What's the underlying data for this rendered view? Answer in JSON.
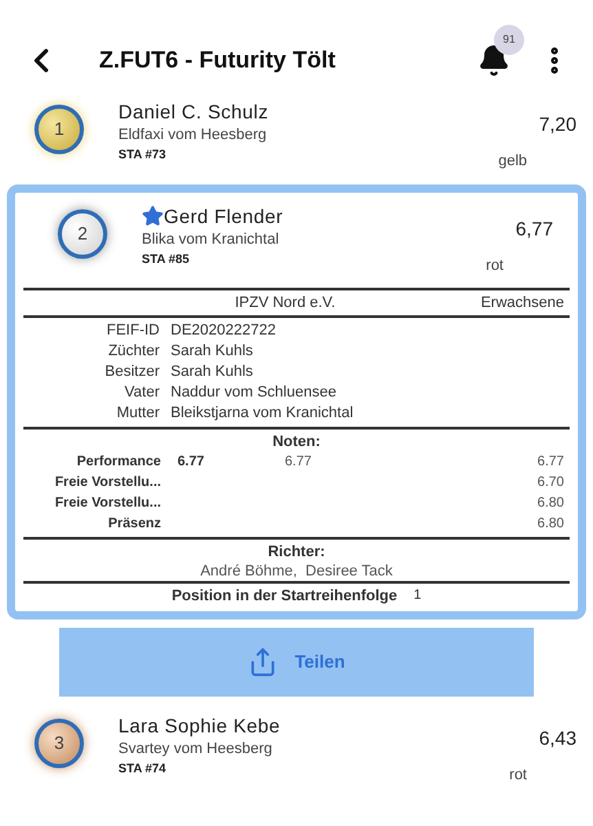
{
  "header": {
    "title": "Z.FUT6 - Futurity Tölt",
    "notification_count": "91"
  },
  "entries": [
    {
      "rank": "1",
      "kind": "gold",
      "favorite": false,
      "expanded": false,
      "rider": "Daniel C. Schulz",
      "horse": "Eldfaxi vom Heesberg",
      "start": "STA #73",
      "score": "7,20",
      "hand": "gelb"
    },
    {
      "rank": "2",
      "kind": "silver",
      "favorite": true,
      "expanded": true,
      "rider": "Gerd Flender",
      "horse": "Blika vom Kranichtal",
      "start": "STA #85",
      "score": "6,77",
      "hand": "rot",
      "details": {
        "club": "IPZV Nord e.V.",
        "class": "Erwachsene",
        "info": [
          {
            "label": "FEIF-ID",
            "value": "DE2020222722"
          },
          {
            "label": "Züchter",
            "value": "Sarah Kuhls"
          },
          {
            "label": "Besitzer",
            "value": "Sarah Kuhls"
          },
          {
            "label": "Vater",
            "value": "Naddur vom Schluensee"
          },
          {
            "label": "Mutter",
            "value": "Bleikstjarna vom Kranichtal"
          }
        ],
        "marks_title": "Noten:",
        "marks": [
          {
            "label": "Performance",
            "total": "6.77",
            "judge_1": "6.77",
            "judge_2": "6.77"
          },
          {
            "label": "Freie Vorstellu...",
            "judge_2": "6.70"
          },
          {
            "label": "Freie Vorstellu...",
            "judge_2": "6.80"
          },
          {
            "label": "Präsenz",
            "judge_2": "6.80"
          }
        ],
        "judges_title": "Richter:",
        "judges": "André Böhme,  Desiree Tack",
        "start_order_label": "Position in der Startreihenfolge",
        "start_order": "1"
      },
      "share_button": "Teilen"
    },
    {
      "rank": "3",
      "kind": "bronze",
      "favorite": false,
      "expanded": false,
      "rider": "Lara Sophie Kebe",
      "horse": "Svartey vom Heesberg",
      "start": "STA #74",
      "score": "6,43",
      "hand": "rot"
    }
  ]
}
